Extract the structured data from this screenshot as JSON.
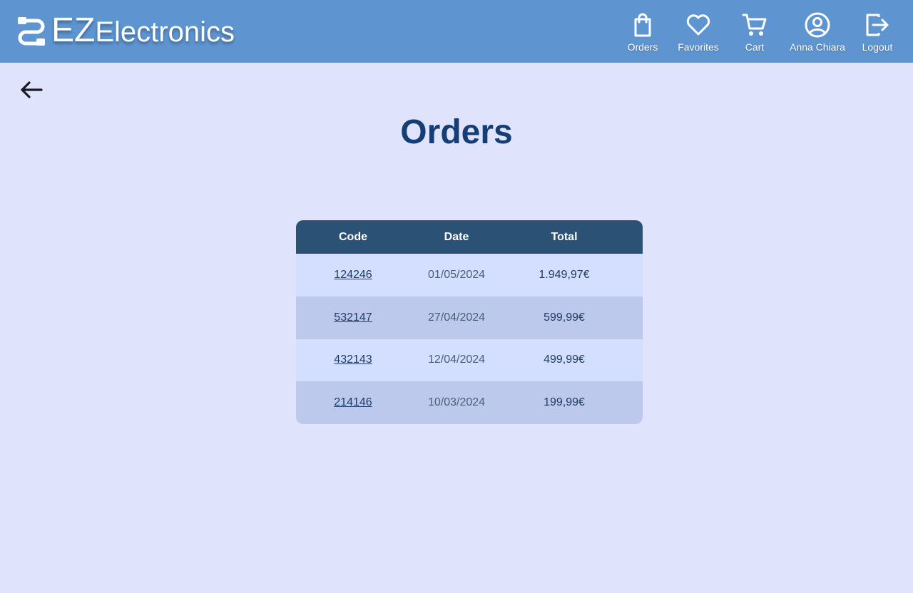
{
  "app": {
    "logo_ez": "EZ",
    "logo_rest": "Electronics"
  },
  "nav": {
    "orders": "Orders",
    "favorites": "Favorites",
    "cart": "Cart",
    "user": "Anna Chiara",
    "logout": "Logout"
  },
  "page": {
    "title": "Orders"
  },
  "table": {
    "headers": [
      "Code",
      "Date",
      "Total"
    ],
    "rows": [
      {
        "code": "124246",
        "date": "01/05/2024",
        "total": "1.949,97€"
      },
      {
        "code": "532147",
        "date": "27/04/2024",
        "total": "599,99€"
      },
      {
        "code": "432143",
        "date": "12/04/2024",
        "total": "499,99€"
      },
      {
        "code": "214146",
        "date": "10/03/2024",
        "total": "199,99€"
      }
    ]
  },
  "colors": {
    "header_bg": "#5e95d1",
    "page_bg": "#dfe3fb",
    "table_head_bg": "#2b5175",
    "row_light": "#d4defe",
    "row_dark": "#bcc9ec",
    "title": "#153f74"
  },
  "icons": {
    "logo": "cable-connector-icon",
    "orders": "shopping-bag-icon",
    "favorites": "heart-icon",
    "cart": "shopping-cart-icon",
    "user": "user-circle-icon",
    "logout": "logout-icon",
    "back": "arrow-left-icon"
  }
}
